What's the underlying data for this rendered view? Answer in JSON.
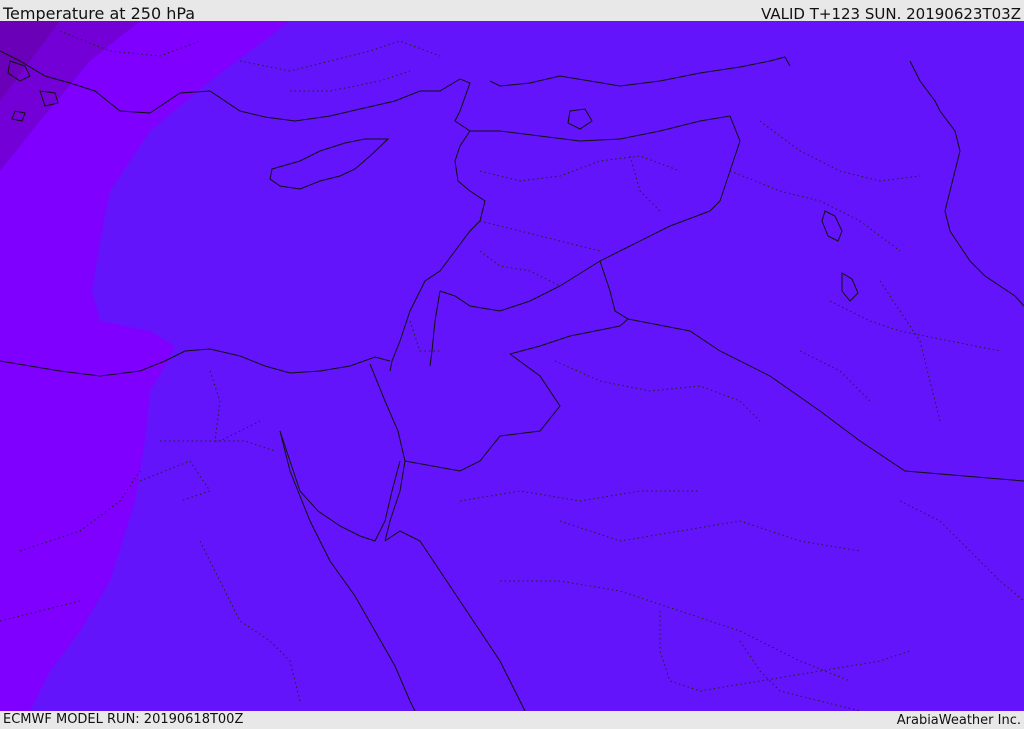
{
  "header": {
    "title": "Temperature at 250 hPa",
    "valid_time": "VALID T+123 SUN. 20190623T03Z"
  },
  "footer": {
    "model_run": "ECMWF MODEL RUN: 20190618T00Z",
    "credit": "ArabiaWeather Inc."
  },
  "colors": {
    "field_main": "#6414fa",
    "field_warm": "#7f00ff",
    "field_west": "#7a00ff",
    "field_corner": "#7200cc",
    "coast": "#111111",
    "background": "#e8e8e8"
  }
}
